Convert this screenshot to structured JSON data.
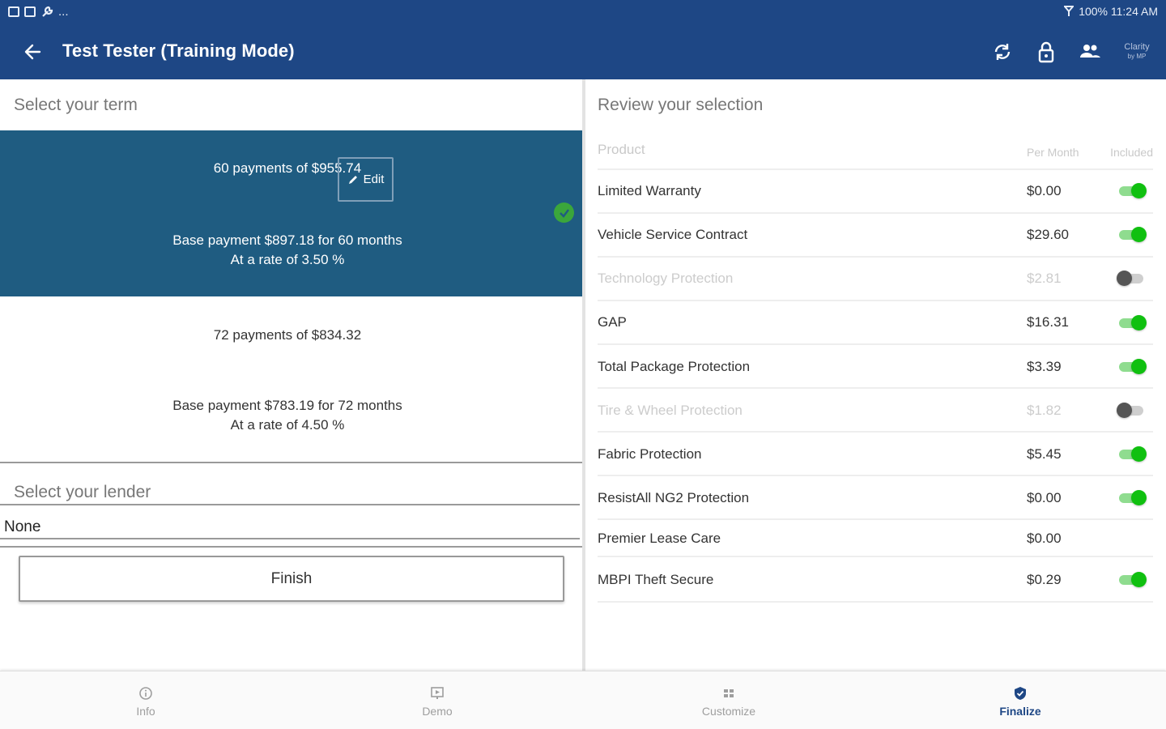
{
  "status_bar": {
    "left_more": "...",
    "right_text": "100% 11:24 AM"
  },
  "app_bar": {
    "title": "Test Tester (Training Mode)",
    "logo_text_top": "Clarity",
    "logo_text_bottom": "by MP"
  },
  "term_section": {
    "header": "Select your term",
    "edit_label": "Edit",
    "options": [
      {
        "payment_line": "60 payments of $955.74",
        "base_line": "Base payment $897.18 for 60 months",
        "rate_line": "At a rate of 3.50 %",
        "selected": true
      },
      {
        "payment_line": "72 payments of $834.32",
        "base_line": "Base payment $783.19 for 72 months",
        "rate_line": "At a rate of 4.50 %",
        "selected": false
      }
    ]
  },
  "lender_section": {
    "header": "Select your lender",
    "value": "None"
  },
  "finish_label": "Finish",
  "review": {
    "header": "Review your selection",
    "columns": {
      "product": "Product",
      "per_month": "Per Month",
      "included": "Included"
    },
    "products": [
      {
        "name": "Limited Warranty",
        "price": "$0.00",
        "toggle": "on"
      },
      {
        "name": "Vehicle Service Contract",
        "price": "$29.60",
        "toggle": "on"
      },
      {
        "name": "Technology Protection",
        "price": "$2.81",
        "toggle": "off"
      },
      {
        "name": "GAP",
        "price": "$16.31",
        "toggle": "on"
      },
      {
        "name": "Total Package Protection",
        "price": "$3.39",
        "toggle": "on"
      },
      {
        "name": "Tire & Wheel Protection",
        "price": "$1.82",
        "toggle": "off"
      },
      {
        "name": "Fabric Protection",
        "price": "$5.45",
        "toggle": "on"
      },
      {
        "name": "ResistAll NG2 Protection",
        "price": "$0.00",
        "toggle": "on"
      },
      {
        "name": "Premier Lease Care",
        "price": "$0.00",
        "toggle": "none"
      },
      {
        "name": "MBPI Theft Secure",
        "price": "$0.29",
        "toggle": "on"
      }
    ]
  },
  "bottom_nav": {
    "items": [
      {
        "label": "Info",
        "icon": "info-icon"
      },
      {
        "label": "Demo",
        "icon": "demo-icon"
      },
      {
        "label": "Customize",
        "icon": "customize-icon"
      },
      {
        "label": "Finalize",
        "icon": "finalize-icon",
        "active": true
      }
    ]
  },
  "colors": {
    "primary": "#1e4785",
    "selected_card": "#1f5c81",
    "toggle_on": "#10c010",
    "check_badge": "#3ba63b"
  }
}
